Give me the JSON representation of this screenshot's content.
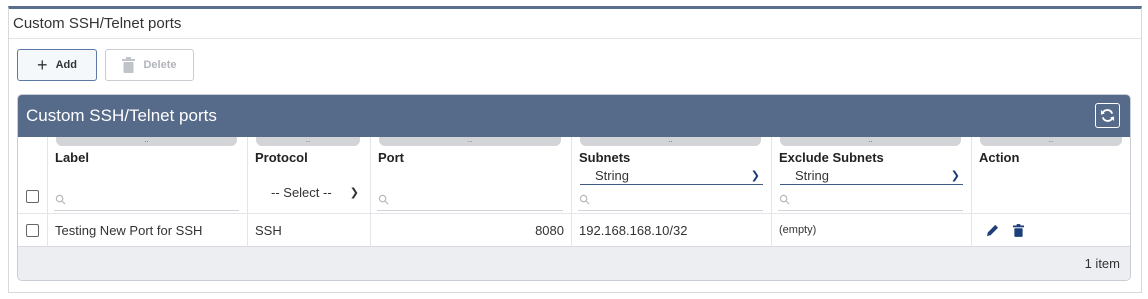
{
  "panel": {
    "title": "Custom SSH/Telnet ports"
  },
  "toolbar": {
    "add_label": "Add",
    "delete_label": "Delete"
  },
  "grid": {
    "title": "Custom SSH/Telnet ports",
    "columns": [
      {
        "label": "Label",
        "filter": "text"
      },
      {
        "label": "Protocol",
        "filter": "select",
        "selected": "-- Select --"
      },
      {
        "label": "Port",
        "filter": "text"
      },
      {
        "label": "Subnets",
        "filter": "select+text",
        "selected": "String"
      },
      {
        "label": "Exclude Subnets",
        "filter": "select+text",
        "selected": "String"
      },
      {
        "label": "Action",
        "filter": "none"
      }
    ],
    "rows": [
      {
        "label": "Testing New Port for SSH",
        "protocol": "SSH",
        "port": "8080",
        "subnets": "192.168.168.10/32",
        "exclude_subnets": "(empty)",
        "actions": [
          "pencil-icon",
          "trash-icon"
        ]
      }
    ],
    "footer": {
      "count": "1 item"
    },
    "grip_glyph": ".."
  },
  "colors": {
    "header_bg": "#566a8a",
    "accent": "#1f3f7a",
    "border": "#5b79a6"
  }
}
